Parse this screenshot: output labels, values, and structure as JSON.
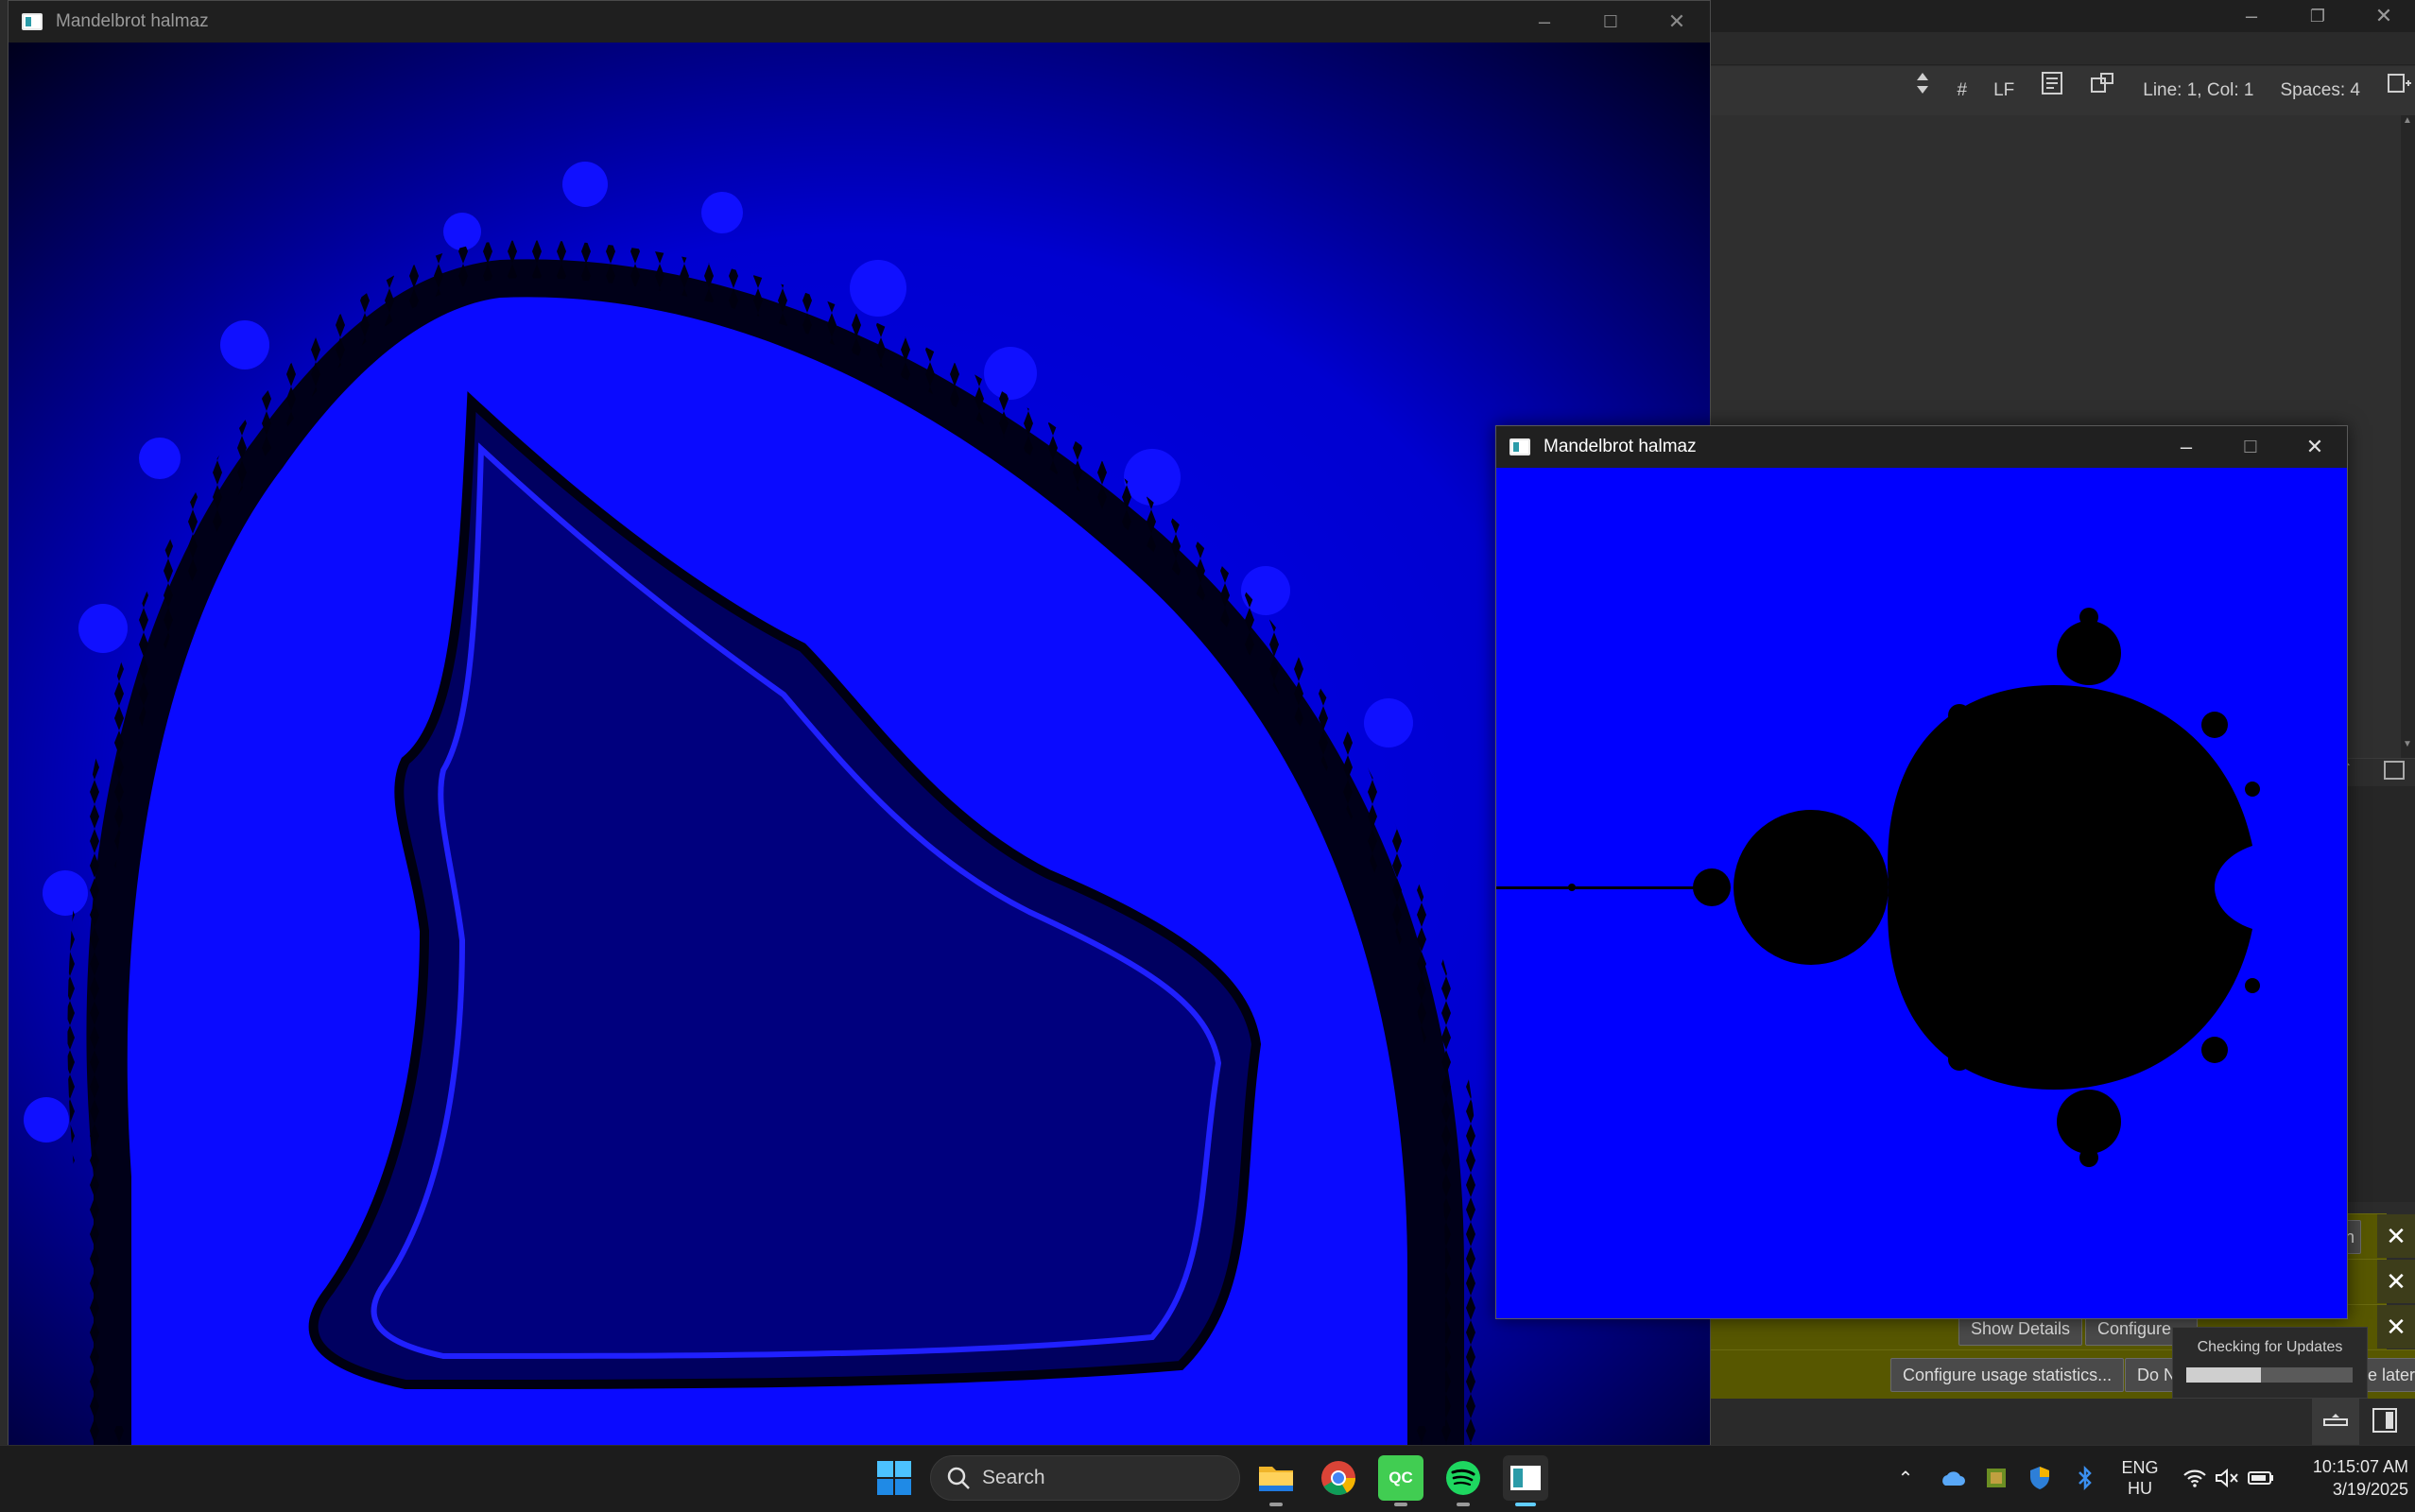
{
  "ide": {
    "toolbar": {
      "hash": "#",
      "line_ending": "LF",
      "cursor_position": "Line: 1, Col: 1",
      "indentation": "Spaces: 4"
    },
    "notifications": {
      "show_details": "Show Details",
      "configure": "Configure...",
      "configure_usage": "Configure usage statistics...",
      "do_not": "Do N",
      "later_suffix": "e later",
      "partial_in": "in"
    }
  },
  "window_main": {
    "title": "Mandelbrot halmaz"
  },
  "window_small": {
    "title": "Mandelbrot halmaz"
  },
  "update_popup": {
    "text": "Checking for Updates",
    "progress": 0.45
  },
  "taskbar": {
    "search_label": "Search",
    "language_line1": "ENG",
    "language_line2": "HU",
    "time": "10:15:07 AM",
    "date": "3/19/2025",
    "apps": [
      "start-icon",
      "file-explorer-icon",
      "chrome-icon",
      "qt-creator-icon",
      "spotify-icon",
      "mandelbrot-app-icon"
    ],
    "qt_label": "QC"
  },
  "colors": {
    "fractal_blue": "#0000ff",
    "fractal_dark": "#000080",
    "notification_yellow": "#575700",
    "taskbar": "#1c1c1c"
  }
}
